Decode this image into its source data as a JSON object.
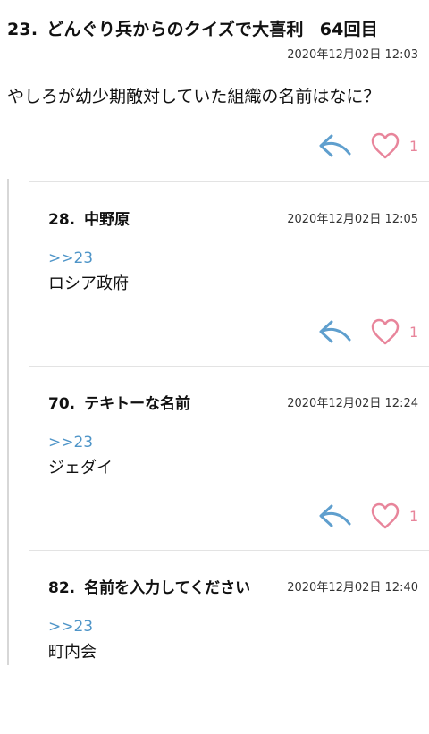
{
  "main": {
    "number": "23.",
    "name": "どんぐり兵からのクイズで大喜利",
    "round": "64回目",
    "date": "2020年12月02日 12:03",
    "body": "やしろが幼少期敵対していた組織の名前はなに？",
    "likes": "1"
  },
  "replies": [
    {
      "number": "28.",
      "name": "中野原",
      "date": "2020年12月02日 12:05",
      "anchor": ">>23",
      "body": "ロシア政府",
      "likes": "1"
    },
    {
      "number": "70.",
      "name": "テキトーな名前",
      "date": "2020年12月02日 12:24",
      "anchor": ">>23",
      "body": "ジェダイ",
      "likes": "1"
    },
    {
      "number": "82.",
      "name": "名前を入力してください",
      "date": "2020年12月02日 12:40",
      "anchor": ">>23",
      "body": "町内会"
    }
  ],
  "colors": {
    "reply_icon": "#5f9fce",
    "like_icon": "#e8859b",
    "anchor_link": "#4f95c8"
  },
  "icons": {
    "reply": "reply-arrow-icon",
    "like": "heart-icon"
  }
}
